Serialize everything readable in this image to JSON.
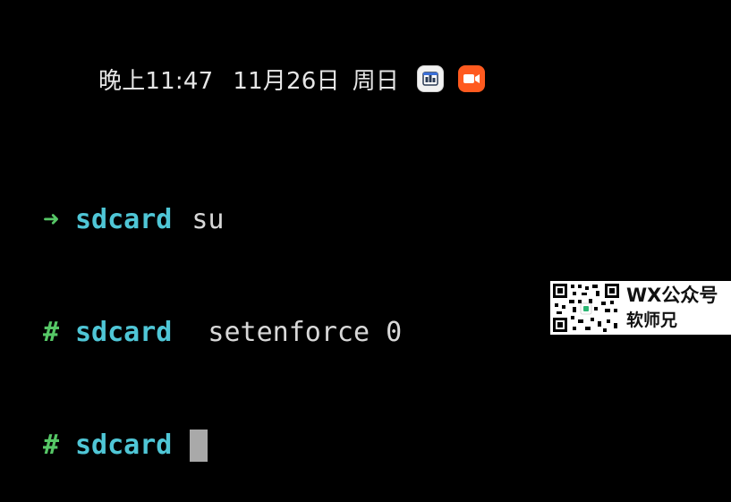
{
  "status_bar": {
    "time": "晚上11:47",
    "date": "11月26日",
    "weekday": "周日",
    "icons": [
      "news-app-icon",
      "video-call-icon"
    ],
    "colors": {
      "text": "#e6e6e6",
      "video_icon_bg": "#ff5a1f"
    }
  },
  "terminal": {
    "lines": [
      {
        "prompt": "➜",
        "cwd": "sdcard",
        "command": "su"
      },
      {
        "prompt": "#",
        "cwd": "sdcard",
        "command": " setenforce 0"
      },
      {
        "prompt": "#",
        "cwd": "sdcard",
        "command": ""
      }
    ],
    "colors": {
      "prompt": "#56c766",
      "cwd": "#4fc6d6",
      "command": "#d8d8d8",
      "cursor": "#a9a9a9",
      "background": "#000000"
    }
  },
  "watermark": {
    "line1": "WX公众号",
    "line2": "软师兄"
  }
}
